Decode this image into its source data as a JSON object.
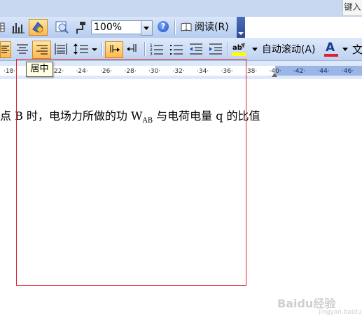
{
  "keyboard_hint": "键入",
  "toolbar_standard": {
    "zoom_value": "100%",
    "read_label": "阅读(R)",
    "icons": [
      "columns-icon",
      "chart-icon",
      "drawing-icon",
      "preview-icon",
      "format-painter-icon",
      "help-icon",
      "book-icon",
      "overflow-chevron-icon"
    ]
  },
  "toolbar_formatting": {
    "auto_scroll_label": "自动滚动(A)",
    "font_color_letter": "A",
    "font_color": "#e0202a",
    "highlight_color": "#ffff00",
    "icons": [
      "align-left-icon",
      "align-center-icon",
      "align-right-icon",
      "distribute-icon",
      "line-spacing-icon",
      "ltr-icon",
      "rtl-icon",
      "numbering-icon",
      "bullets-icon",
      "decrease-indent-icon",
      "increase-indent-icon",
      "highlight-icon",
      "font-color-icon",
      "phonetic-guide-icon"
    ]
  },
  "tooltip": {
    "text": "居中"
  },
  "ruler": {
    "ticks": [
      "18",
      "20",
      "22",
      "24",
      "26",
      "28",
      "30",
      "32",
      "34",
      "36",
      "38",
      "40",
      "42",
      "44",
      "46"
    ]
  },
  "document": {
    "line_prefix": "点 B 时，电场力所做的功 W",
    "subscript": "AB",
    "line_suffix": " 与电荷电量 q 的比值"
  },
  "watermark": {
    "text": "Baidu经验",
    "sub": "jingyan.baidu.com"
  }
}
